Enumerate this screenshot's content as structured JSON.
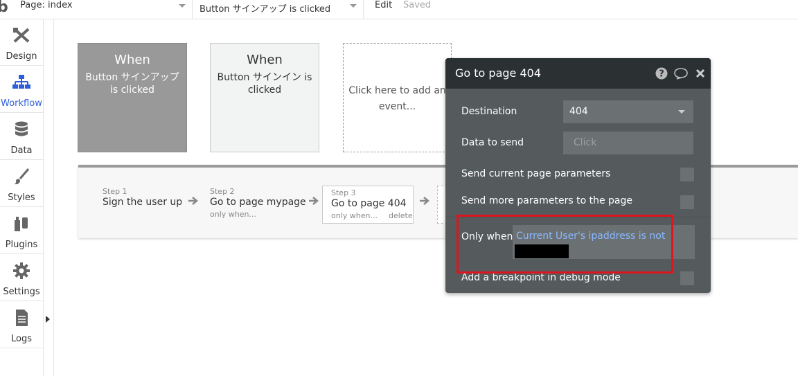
{
  "topbar": {
    "logo": "b",
    "page_select": "Page: index",
    "event_select": "Button サインアップ is clicked",
    "edit_menu": "Edit",
    "save_status": "Saved"
  },
  "sidebar": {
    "items": [
      {
        "label": "Design",
        "icon": "design-icon"
      },
      {
        "label": "Workflow",
        "icon": "workflow-icon",
        "active": true
      },
      {
        "label": "Data",
        "icon": "data-icon"
      },
      {
        "label": "Styles",
        "icon": "styles-icon"
      },
      {
        "label": "Plugins",
        "icon": "plugins-icon"
      },
      {
        "label": "Settings",
        "icon": "settings-icon"
      },
      {
        "label": "Logs",
        "icon": "logs-icon"
      }
    ]
  },
  "events": [
    {
      "when": "When",
      "event": "Button サインアップ is clicked",
      "selected": true
    },
    {
      "when": "When",
      "event": "Button サインイン is clicked",
      "selected": false
    }
  ],
  "add_event_label": "Click here to add an event...",
  "steps": [
    {
      "num": "Step 1",
      "title": "Sign the user up",
      "sub": ""
    },
    {
      "num": "Step 2",
      "title": "Go to page mypage",
      "sub": "only when..."
    },
    {
      "num": "Step 3",
      "title": "Go to page 404",
      "sub": "only when...",
      "delete": "delete"
    }
  ],
  "editor": {
    "title": "Go to page 404",
    "header_icons": [
      "help-icon",
      "comment-icon",
      "close-icon"
    ],
    "destination_label": "Destination",
    "destination_value": "404",
    "data_to_send_label": "Data to send",
    "data_to_send_placeholder": "Click",
    "send_current_params_label": "Send current page parameters",
    "send_more_params_label": "Send more parameters to the page",
    "only_when_label": "Only when",
    "only_when_value": "Current User's ipaddress is not",
    "breakpoint_label": "Add a breakpoint in debug mode"
  },
  "colors": {
    "highlight": "#e0141e",
    "active_nav": "#2f5fd8",
    "condition_text": "#8ab8ff",
    "editor_bg": "#555b5d",
    "editor_header": "#2b3133"
  }
}
